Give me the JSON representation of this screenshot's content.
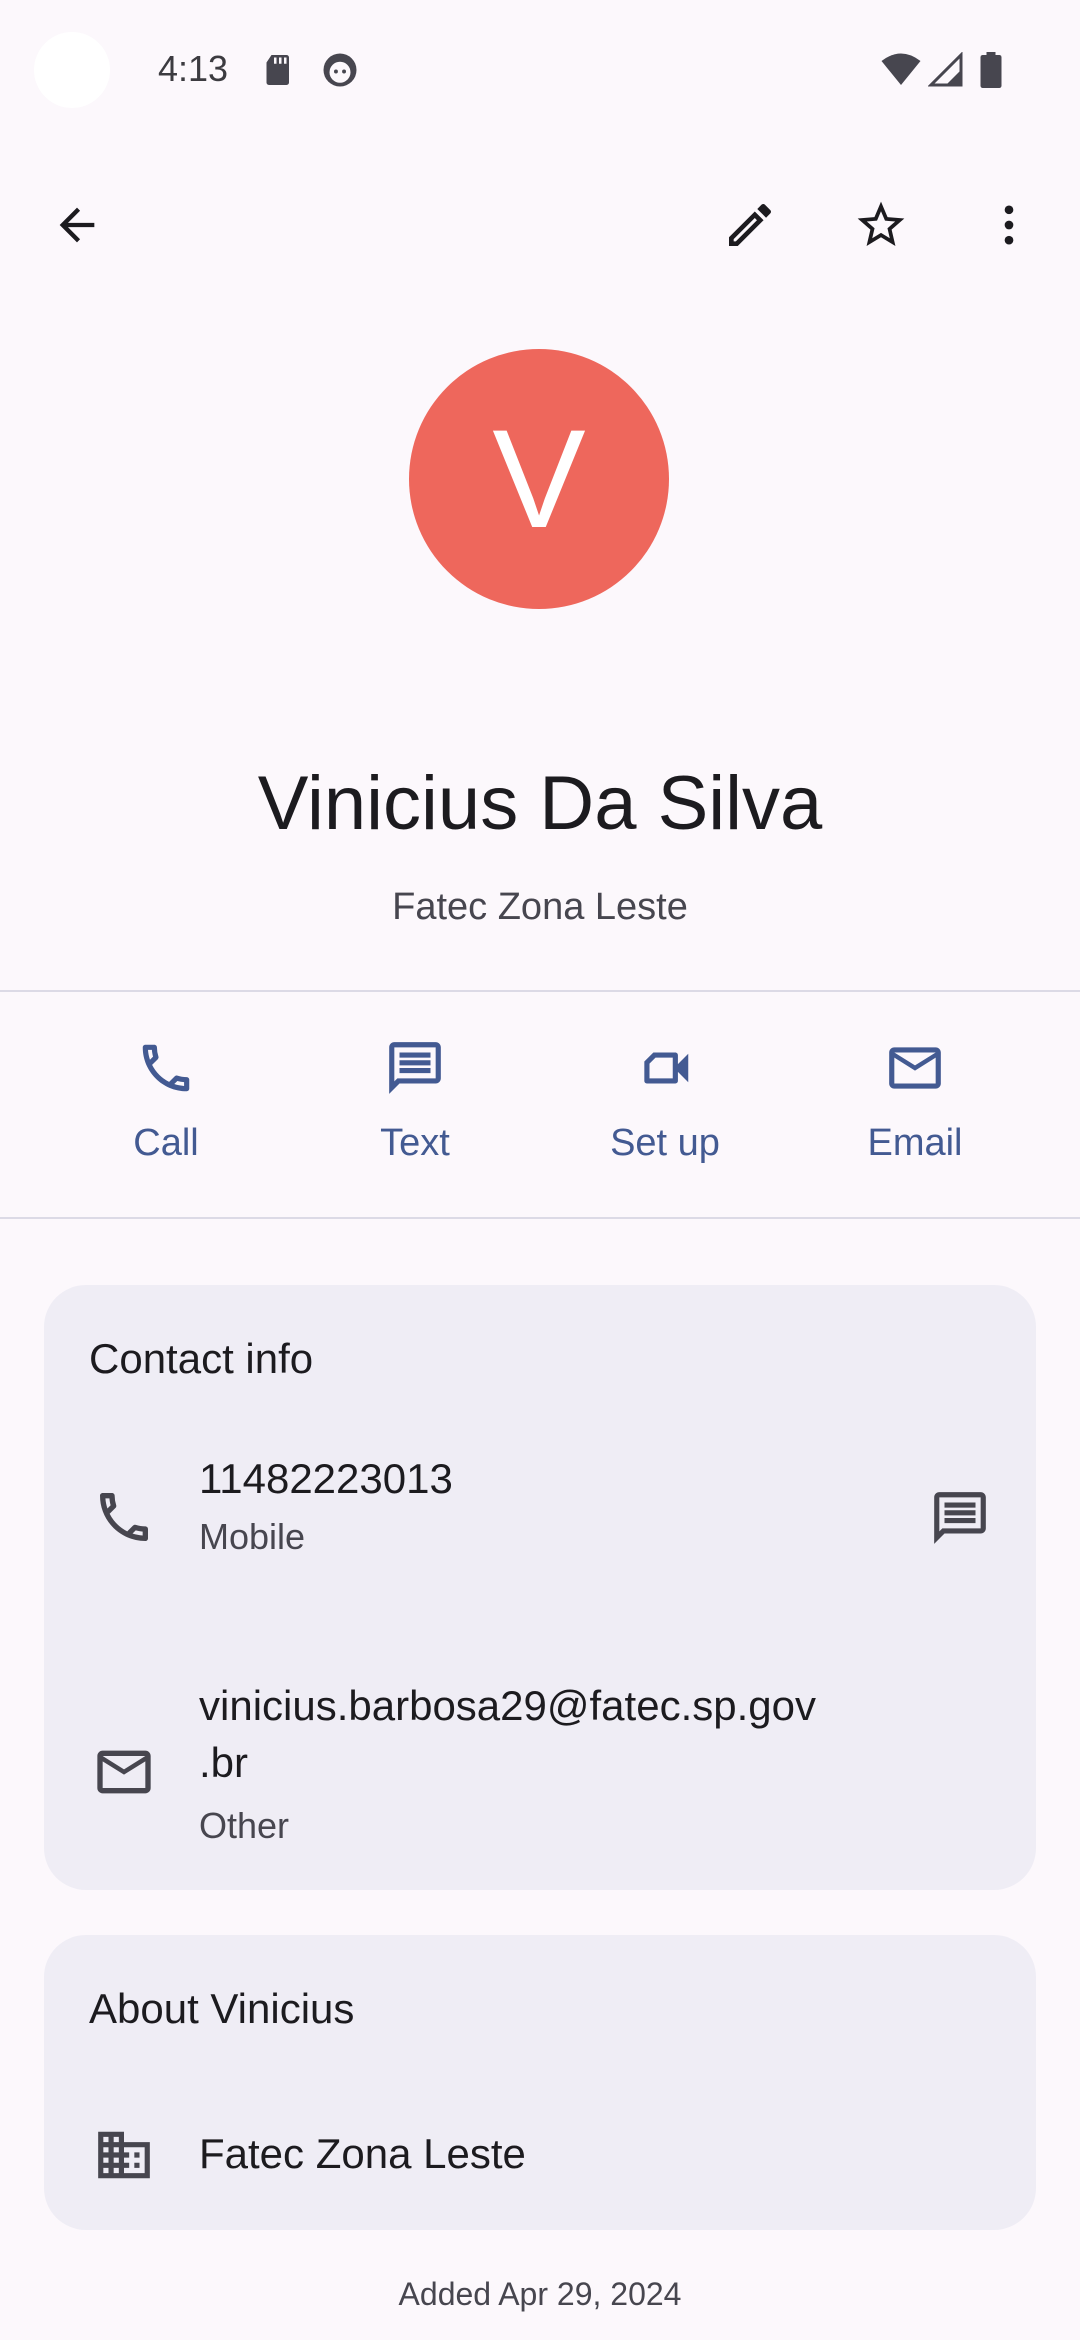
{
  "status_bar": {
    "time": "4:13",
    "icons": [
      "sd-card-icon",
      "face-icon",
      "wifi-icon",
      "cell-signal-icon",
      "battery-icon"
    ]
  },
  "top_bar": {
    "icons": [
      "back-arrow-icon",
      "edit-pencil-icon",
      "star-outline-icon",
      "more-vert-icon"
    ]
  },
  "contact": {
    "avatar_letter": "V",
    "avatar_color": "#ee675c",
    "name": "Vinicius Da Silva",
    "company": "Fatec Zona Leste"
  },
  "actions": [
    {
      "label": "Call",
      "icon": "phone-icon"
    },
    {
      "label": "Text",
      "icon": "message-icon"
    },
    {
      "label": "Set up",
      "icon": "video-camera-icon"
    },
    {
      "label": "Email",
      "icon": "mail-icon"
    }
  ],
  "contact_info": {
    "title": "Contact info",
    "phone": {
      "value": "11482223013",
      "type": "Mobile",
      "icon": "phone-icon",
      "action_icon": "message-icon"
    },
    "email": {
      "line1": "vinicius.barbosa29@fatec.sp.gov",
      "line2": ".br",
      "type": "Other",
      "icon": "mail-icon"
    }
  },
  "about": {
    "title": "About Vinicius",
    "company": "Fatec Zona Leste",
    "icon": "building-icon"
  },
  "footer": {
    "added": "Added Apr 29, 2024"
  },
  "colors": {
    "accent": "#435a92",
    "card_bg": "#efedf5",
    "background": "#fcf8fc"
  }
}
